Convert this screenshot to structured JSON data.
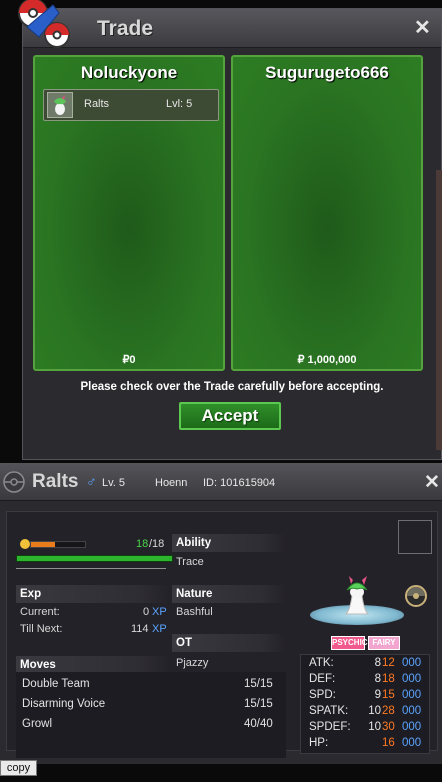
{
  "trade": {
    "title": "Trade",
    "left_player": "Noluckyone",
    "right_player": "Sugurugeto666",
    "offer": {
      "name": "Ralts",
      "level": "Lvl: 5"
    },
    "left_money": "₽0",
    "right_money": "₽ 1,000,000",
    "message": "Please check over the Trade carefully before accepting.",
    "accept_label": "Accept",
    "close": "✕"
  },
  "pokemon": {
    "name": "Ralts",
    "gender_symbol": "♂",
    "level": "Lv. 5",
    "region": "Hoenn",
    "id": "ID: 101615904",
    "close": "✕",
    "hp_current": "18",
    "hp_sep": "/18",
    "hp_fraction": 1.0,
    "happiness_fraction": 0.45,
    "exp": {
      "header": "Exp",
      "current_label": "Current:",
      "current_value": "0",
      "till_next_label": "Till Next:",
      "till_next_value": "114",
      "unit": "XP"
    },
    "ability": {
      "header": "Ability",
      "value": "Trace"
    },
    "nature": {
      "header": "Nature",
      "value": "Bashful"
    },
    "ot": {
      "header": "OT",
      "value": "Pjazzy"
    },
    "moves": {
      "header": "Moves",
      "list": [
        {
          "name": "Double Team",
          "pp": "15/15"
        },
        {
          "name": "Disarming Voice",
          "pp": "15/15"
        },
        {
          "name": "Growl",
          "pp": "40/40"
        }
      ]
    },
    "types": [
      "PSYCHIC",
      "FAIRY"
    ],
    "type_colors": {
      "psychic": "#f05a8c",
      "fairy": "#f2a6cf"
    },
    "stats": [
      {
        "label": "ATK:",
        "base": "8",
        "iv": "12",
        "ev": "000"
      },
      {
        "label": "DEF:",
        "base": "8",
        "iv": "18",
        "ev": "000"
      },
      {
        "label": "SPD:",
        "base": "9",
        "iv": "15",
        "ev": "000"
      },
      {
        "label": "SPATK:",
        "base": "10",
        "iv": "28",
        "ev": "000"
      },
      {
        "label": "SPDEF:",
        "base": "10",
        "iv": "30",
        "ev": "000"
      },
      {
        "label": "HP:",
        "base": "",
        "iv": "16",
        "ev": "000"
      }
    ]
  },
  "copy_label": "copy",
  "colors": {
    "panel_green": "#2d7d23",
    "accept_green": "#2f8f2a",
    "iv_orange": "#ff7a22",
    "ev_blue": "#5aa4ff"
  }
}
